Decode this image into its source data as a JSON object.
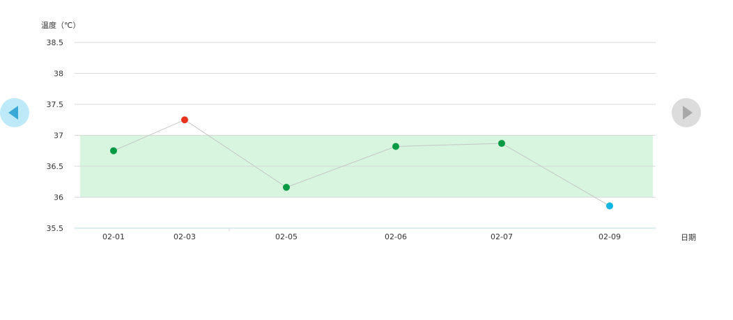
{
  "chart_data": {
    "type": "line",
    "ylabel": "温度（℃）",
    "xlabel": "日期",
    "ylim": [
      35.5,
      38.5
    ],
    "yticks": [
      "38.5",
      "38",
      "37.5",
      "37",
      "36.5",
      "36",
      "35.5"
    ],
    "ytick_values": [
      38.5,
      38,
      37.5,
      37,
      36.5,
      36,
      35.5
    ],
    "categories": [
      "02-01",
      "02-03",
      "02-05",
      "02-06",
      "02-07",
      "02-09"
    ],
    "values": [
      36.75,
      37.25,
      36.16,
      36.82,
      36.87,
      35.86
    ],
    "point_colors": [
      "#009a44",
      "#e8321e",
      "#009a44",
      "#009a44",
      "#009a44",
      "#11b5e4"
    ],
    "normal_range": [
      36,
      37
    ],
    "colors": {
      "normal_band": "#d8f5df",
      "normal_band_edge": "#8ddc9b",
      "grid": "#d9d9d9",
      "line": "#c6c6c6",
      "x_axis": "#b9dce0"
    }
  },
  "nav": {
    "prev_icon": "arrow-left-icon",
    "next_icon": "arrow-right-icon"
  }
}
